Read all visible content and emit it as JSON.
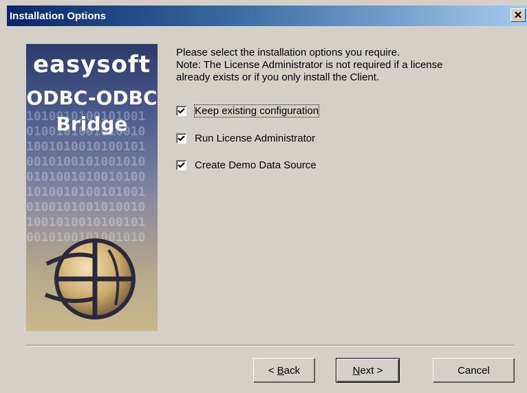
{
  "window": {
    "title": "Installation Options"
  },
  "banner": {
    "brand": "easysoft",
    "product_line1": "ODBC-ODBC",
    "product_line2": "Bridge"
  },
  "intro": {
    "line1": "Please select the installation options you require.",
    "line2": "Note: The License Administrator is not required if a license",
    "line3": "already exists or if you only install the Client."
  },
  "options": [
    {
      "label": "Keep existing configuration",
      "checked": true
    },
    {
      "label": "Run License Administrator",
      "checked": true
    },
    {
      "label": "Create Demo Data Source",
      "checked": true
    }
  ],
  "buttons": {
    "back": {
      "lead": "< ",
      "mnemonic": "B",
      "rest": "ack"
    },
    "next": {
      "mnemonic": "N",
      "rest": "ext >"
    },
    "cancel": "Cancel"
  },
  "colors": {
    "title_start": "#0a246a",
    "title_end": "#a6caf0",
    "face": "#d4d0c8"
  }
}
